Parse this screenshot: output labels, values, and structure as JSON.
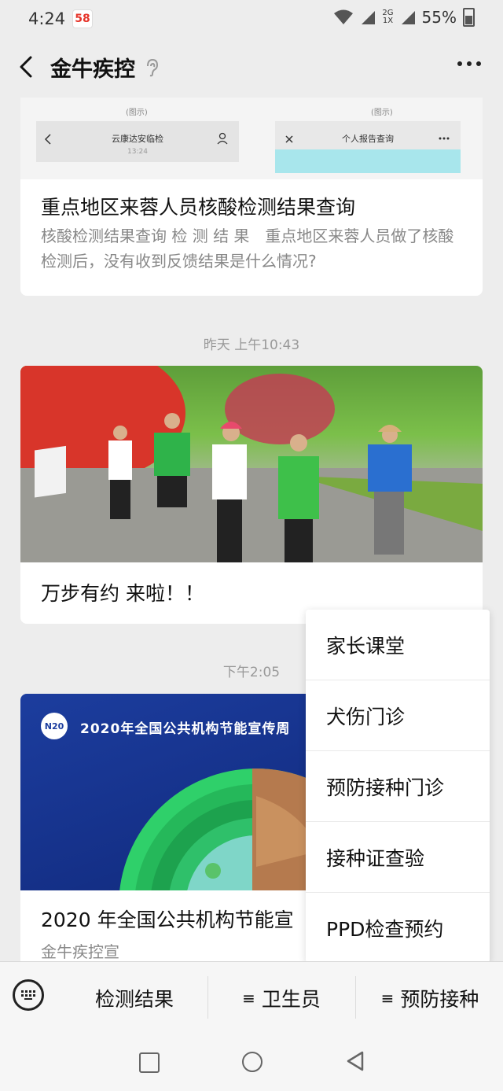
{
  "status_bar": {
    "time": "4:24",
    "app_badge": "58",
    "network_top": "2G",
    "network_bottom": "1X",
    "battery": "55%"
  },
  "nav": {
    "title": "金牛疾控"
  },
  "feed": {
    "article1": {
      "img_label_left": "(图示)",
      "img_label_right": "(图示)",
      "mini_left_title": "云康达安临检",
      "mini_left_time": "13:24",
      "mini_right_title": "个人报告查询",
      "title": "重点地区来蓉人员核酸检测结果查询",
      "desc": "核酸检测结果查询 检 测 结 果　重点地区来蓉人员做了核酸检测后，没有收到反馈结果是什么情况?"
    },
    "time2": "昨天 上午10:43",
    "article2": {
      "title": "万步有约 来啦！！"
    },
    "time3": "下午2:05",
    "article3": {
      "image_heading": "2020年全国公共机构节能宣传周",
      "logo_text": "N20",
      "title": "2020 年全国公共机构节能宣",
      "source": "金牛疾控宣"
    }
  },
  "popup_menu": {
    "items": [
      "家长课堂",
      "犬伤门诊",
      "预防接种门诊",
      "接种证查验",
      "PPD检查预约"
    ]
  },
  "bottom_menu": {
    "items": [
      "检测结果",
      "卫生员",
      "预防接种"
    ],
    "hamburger": "≡"
  },
  "colors": {
    "background": "#ededed",
    "card": "#ffffff",
    "muted_text": "#888888"
  }
}
